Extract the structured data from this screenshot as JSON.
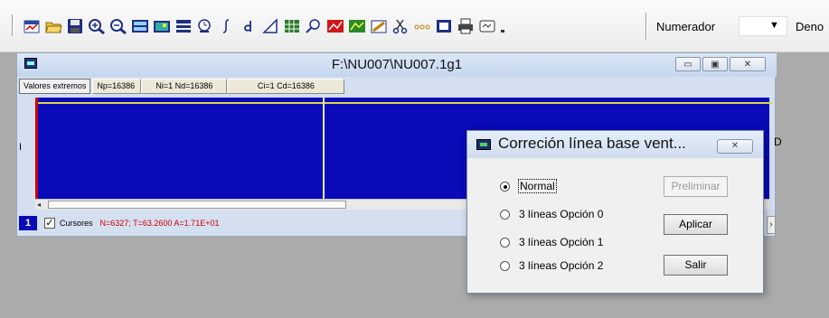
{
  "toolbar": {
    "icons": [
      "save-sheet-icon",
      "open-folder-icon",
      "floppy-save-icon",
      "zoom-in-icon",
      "zoom-out-icon",
      "chart-view-icon",
      "image-view-icon",
      "layout-icon",
      "time-icon",
      "integral-icon",
      "derivative-icon",
      "triangle-ruler-icon",
      "grid-table-icon",
      "search-icon",
      "red-chart-icon",
      "green-chart-icon",
      "pencil-icon",
      "cut-icon",
      "ellipsis-icon",
      "frame-icon",
      "print-icon",
      "window-icon"
    ],
    "numerador_label": "Numerador",
    "numerador_value": "",
    "denominador_label": "Deno"
  },
  "mdi": {
    "title": "F:\\NU007\\NU007.1g1",
    "tabs": {
      "extremes_button": "Valores extremos",
      "np": "Np=16386",
      "ni_nd": "Ni=1 Nd=16386",
      "ci_cd": "Ci=1 Cd=16386"
    },
    "plot_left_label": "I",
    "status": {
      "channel": "1",
      "cursors_label": "Cursores",
      "cursor_info": "N=6327; T=63.2600  A=1.71E+01",
      "cursors_checked": true
    },
    "edge_label": "D"
  },
  "dialog": {
    "title": "Correción línea base vent...",
    "options": [
      {
        "label": "Normal",
        "checked": true
      },
      {
        "label": "3 líneas Opción 0",
        "checked": false
      },
      {
        "label": "3 líneas Opción 1",
        "checked": false
      },
      {
        "label": "3 líneas Opción 2",
        "checked": false
      }
    ],
    "buttons": {
      "preliminar": "Preliminar",
      "aplicar": "Aplicar",
      "salir": "Salir"
    }
  },
  "colors": {
    "plot_bg": "#0a0ab8",
    "cursor_info": "#d00000",
    "app_bg": "#ababab"
  }
}
